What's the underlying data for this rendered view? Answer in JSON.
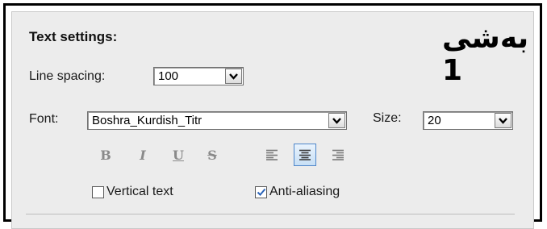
{
  "panel": {
    "title": "Text settings:",
    "watermark": "بەشی 1"
  },
  "line_spacing": {
    "label": "Line spacing:",
    "value": "100"
  },
  "font": {
    "label": "Font:",
    "value": "Boshra_Kurdish_Titr"
  },
  "size": {
    "label": "Size:",
    "value": "20"
  },
  "formatting": {
    "bold": "B",
    "italic": "I",
    "underline": "U",
    "strikethrough": "S"
  },
  "alignment": {
    "selected": "center",
    "options": [
      "left",
      "center",
      "right"
    ]
  },
  "checkboxes": {
    "vertical_text": {
      "label": "Vertical text",
      "checked": false
    },
    "anti_aliasing": {
      "label": "Anti-aliasing",
      "checked": true
    }
  },
  "colors": {
    "panel_bg": "#ececec",
    "active_align": "#c7dff5",
    "check_blue": "#2a63b8"
  }
}
